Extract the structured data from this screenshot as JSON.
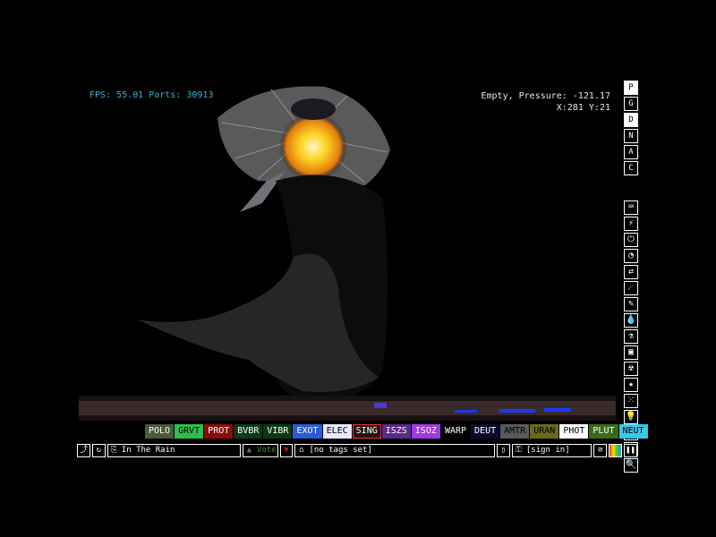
{
  "hud": {
    "fps_label": "FPS: 55.01 Parts: 30913",
    "pressure": "Empty, Pressure: -121.17",
    "coords": "X:281 Y:21"
  },
  "modes": [
    "P",
    "G",
    "D",
    "N",
    "A",
    "C"
  ],
  "categories": [
    {
      "icon": "keyboard-icon",
      "glyph": "⌨"
    },
    {
      "icon": "plug-icon",
      "glyph": "⚡"
    },
    {
      "icon": "power-icon",
      "glyph": "⏻"
    },
    {
      "icon": "gauge-icon",
      "glyph": "◔"
    },
    {
      "icon": "arrows-icon",
      "glyph": "⇄"
    },
    {
      "icon": "spray-icon",
      "glyph": "☄"
    },
    {
      "icon": "pencil-icon",
      "glyph": "✎"
    },
    {
      "icon": "drop-icon",
      "glyph": "💧"
    },
    {
      "icon": "flask-icon",
      "glyph": "⚗"
    },
    {
      "icon": "square-icon",
      "glyph": "▣"
    },
    {
      "icon": "radioactive-icon",
      "glyph": "☢"
    },
    {
      "icon": "star-icon",
      "glyph": "★"
    },
    {
      "icon": "dots-icon",
      "glyph": "⁙"
    },
    {
      "icon": "bulb-icon",
      "glyph": "💡"
    },
    {
      "icon": "bookmark-icon",
      "glyph": "🔖"
    },
    {
      "icon": "tools-icon",
      "glyph": "⚒"
    },
    {
      "icon": "search-icon",
      "glyph": "🔍"
    }
  ],
  "elements": [
    {
      "label": "POLO",
      "bg": "#4a5a3a",
      "fg": "#ffffff"
    },
    {
      "label": "GRVT",
      "bg": "#2dbf4a",
      "fg": "#000000"
    },
    {
      "label": "PROT",
      "bg": "#8a0c0c",
      "fg": "#ffffff"
    },
    {
      "label": "BVBR",
      "bg": "#0c3a1a",
      "fg": "#ffffff"
    },
    {
      "label": "VIBR",
      "bg": "#0a3a10",
      "fg": "#ffffff"
    },
    {
      "label": "EXOT",
      "bg": "#2a5ad8",
      "fg": "#ffffff"
    },
    {
      "label": "ELEC",
      "bg": "#e8e8ff",
      "fg": "#000000"
    },
    {
      "label": "SING",
      "bg": "#241414",
      "fg": "#ffffff",
      "selected": true
    },
    {
      "label": "ISZS",
      "bg": "#5a2a8a",
      "fg": "#ffffff"
    },
    {
      "label": "ISOZ",
      "bg": "#a03adf",
      "fg": "#ffffff"
    },
    {
      "label": "WARP",
      "bg": "#000000",
      "fg": "#ffffff"
    },
    {
      "label": "DEUT",
      "bg": "#0a0a30",
      "fg": "#ffffff"
    },
    {
      "label": "AMTR",
      "bg": "#5a5a5a",
      "fg": "#000000"
    },
    {
      "label": "URAN",
      "bg": "#6a6a1a",
      "fg": "#000000"
    },
    {
      "label": "PHOT",
      "bg": "#ffffff",
      "fg": "#000000"
    },
    {
      "label": "PLUT",
      "bg": "#3a6a1a",
      "fg": "#ffffff"
    },
    {
      "label": "NEUT",
      "bg": "#3ac8e8",
      "fg": "#000000"
    }
  ],
  "bottom": {
    "save_title": "In The Rain",
    "vote_label": "Vote",
    "tags": "[no tags set]",
    "sign_in": "[sign in]"
  }
}
